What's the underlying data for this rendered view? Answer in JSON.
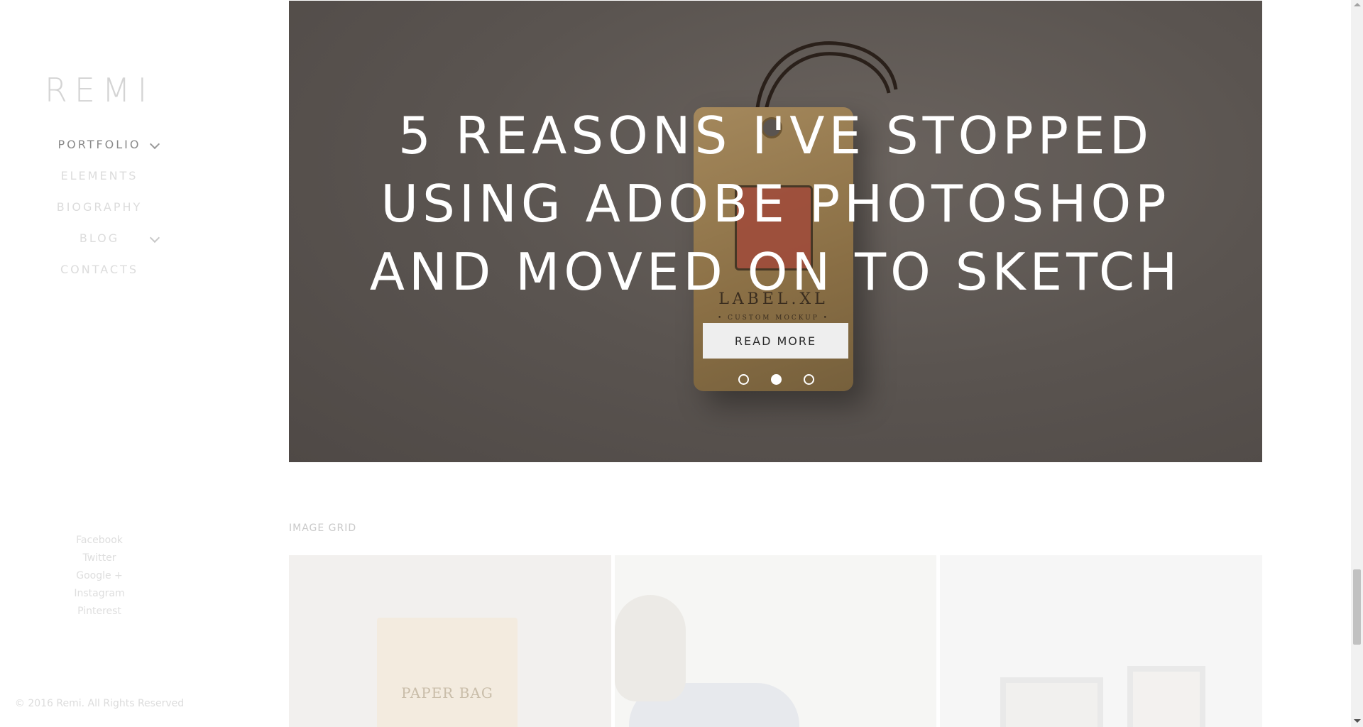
{
  "brand": {
    "logo": "REMI"
  },
  "nav": {
    "items": [
      {
        "label": "PORTFOLIO",
        "has_submenu": true,
        "active": true
      },
      {
        "label": "ELEMENTS",
        "has_submenu": false,
        "active": false
      },
      {
        "label": "BIOGRAPHY",
        "has_submenu": false,
        "active": false
      },
      {
        "label": "BLOG",
        "has_submenu": true,
        "active": false
      },
      {
        "label": "CONTACTS",
        "has_submenu": false,
        "active": false
      }
    ]
  },
  "social": [
    "Facebook",
    "Twitter",
    "Google +",
    "Instagram",
    "Pinterest"
  ],
  "footer": {
    "copyright": "© 2016 Remi. All Rights Reserved"
  },
  "hero": {
    "title_lines": [
      "5 REASONS I'VE STOPPED",
      "USING ADOBE PHOTOSHOP",
      "AND MOVED ON TO SKETCH"
    ],
    "button_label": "READ MORE",
    "image_text": {
      "title": "LABEL.XL",
      "subtitle": "• CUSTOM MOCKUP •"
    },
    "slider": {
      "count": 3,
      "active_index": 1
    }
  },
  "grid": {
    "label": "IMAGE GRID",
    "images": [
      {
        "name": "paper-bag",
        "text": "PAPER BAG"
      },
      {
        "name": "man-portrait",
        "text": ""
      },
      {
        "name": "framed-pictures",
        "text": ""
      }
    ]
  },
  "colors": {
    "hero_overlay": "#5a5450",
    "button_bg": "#eeeeee",
    "text_light": "#dcdcdc"
  }
}
